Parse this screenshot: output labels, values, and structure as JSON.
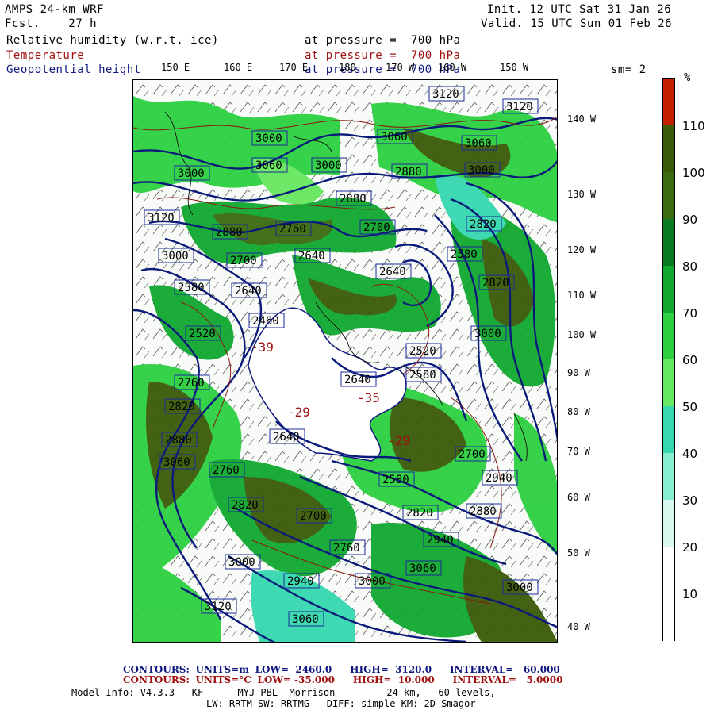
{
  "header": {
    "model": "AMPS 24-km WRF",
    "fcst_label": "Fcst.",
    "fcst_value": "27 h",
    "init": "Init. 12 UTC Sat 31 Jan 26",
    "valid": "Valid. 15 UTC Sun 01 Feb 26",
    "field1": "Relative humidity (w.r.t. ice)",
    "field2": "Temperature",
    "field3": "Geopotential height",
    "pressure1": "at pressure =  700 hPa",
    "pressure2": "at pressure =  700 hPa",
    "pressure3": "at pressure =  700 hPa",
    "smooth": "sm= 2"
  },
  "lon_labels": [
    "150 E",
    "160 E",
    "170 E",
    "180",
    "170 W",
    "160 W",
    "150 W"
  ],
  "lat_labels": [
    "140 W",
    "130 W",
    "120 W",
    "110 W",
    "100 W",
    "90 W",
    "80 W",
    "70 W",
    "60 W",
    "50 W",
    "40 W"
  ],
  "colorbar": {
    "unit": "%",
    "ticks": [
      "110",
      "100",
      "90",
      "80",
      "70",
      "60",
      "50",
      "40",
      "30",
      "20",
      "10"
    ],
    "colors": [
      "#c42000",
      "#3a5a08",
      "#3b6b10",
      "#0a7a20",
      "#10a830",
      "#2cd040",
      "#66e860",
      "#36d8b0",
      "#88f0d0",
      "#d8f8f0",
      "#ffffff",
      "#ffffff"
    ]
  },
  "height_labels": [
    "3120",
    "3120",
    "3000",
    "3060",
    "3060",
    "3000",
    "3060",
    "3000",
    "2880",
    "3000",
    "2880",
    "3120",
    "2880",
    "2760",
    "2700",
    "2820",
    "3000",
    "2700",
    "2640",
    "2640",
    "2580",
    "2820",
    "2580",
    "2640",
    "2460",
    "2520",
    "2760",
    "2820",
    "3000",
    "2520",
    "2640",
    "2580",
    "2700",
    "2940",
    "2760",
    "2820",
    "2880",
    "3060",
    "2640",
    "2580",
    "2700",
    "2760",
    "2820",
    "2880",
    "2940",
    "3060",
    "3000",
    "2940",
    "3120",
    "3060",
    "3000",
    "3000"
  ],
  "temp_labels": [
    "-39",
    "-29",
    "-35",
    "-29"
  ],
  "footer": {
    "c1_label": "CONTOURS:",
    "c1_units": "UNITS=m",
    "c1_low": "LOW=  2460.0",
    "c1_high": "HIGH=  3120.0",
    "c1_int": "INTERVAL=   60.000",
    "c2_label": "CONTOURS:",
    "c2_units": "UNITS=°C",
    "c2_low": "LOW= -35.000",
    "c2_high": "HIGH=  10.000",
    "c2_int": "INTERVAL=   5.0000",
    "model_info": "Model Info: V4.3.3   KF      MYJ PBL  Morrison         24 km,   60 levels,",
    "model_info2": "LW: RRTM SW: RRTMG   DIFF: simple KM: 2D Smagor"
  }
}
